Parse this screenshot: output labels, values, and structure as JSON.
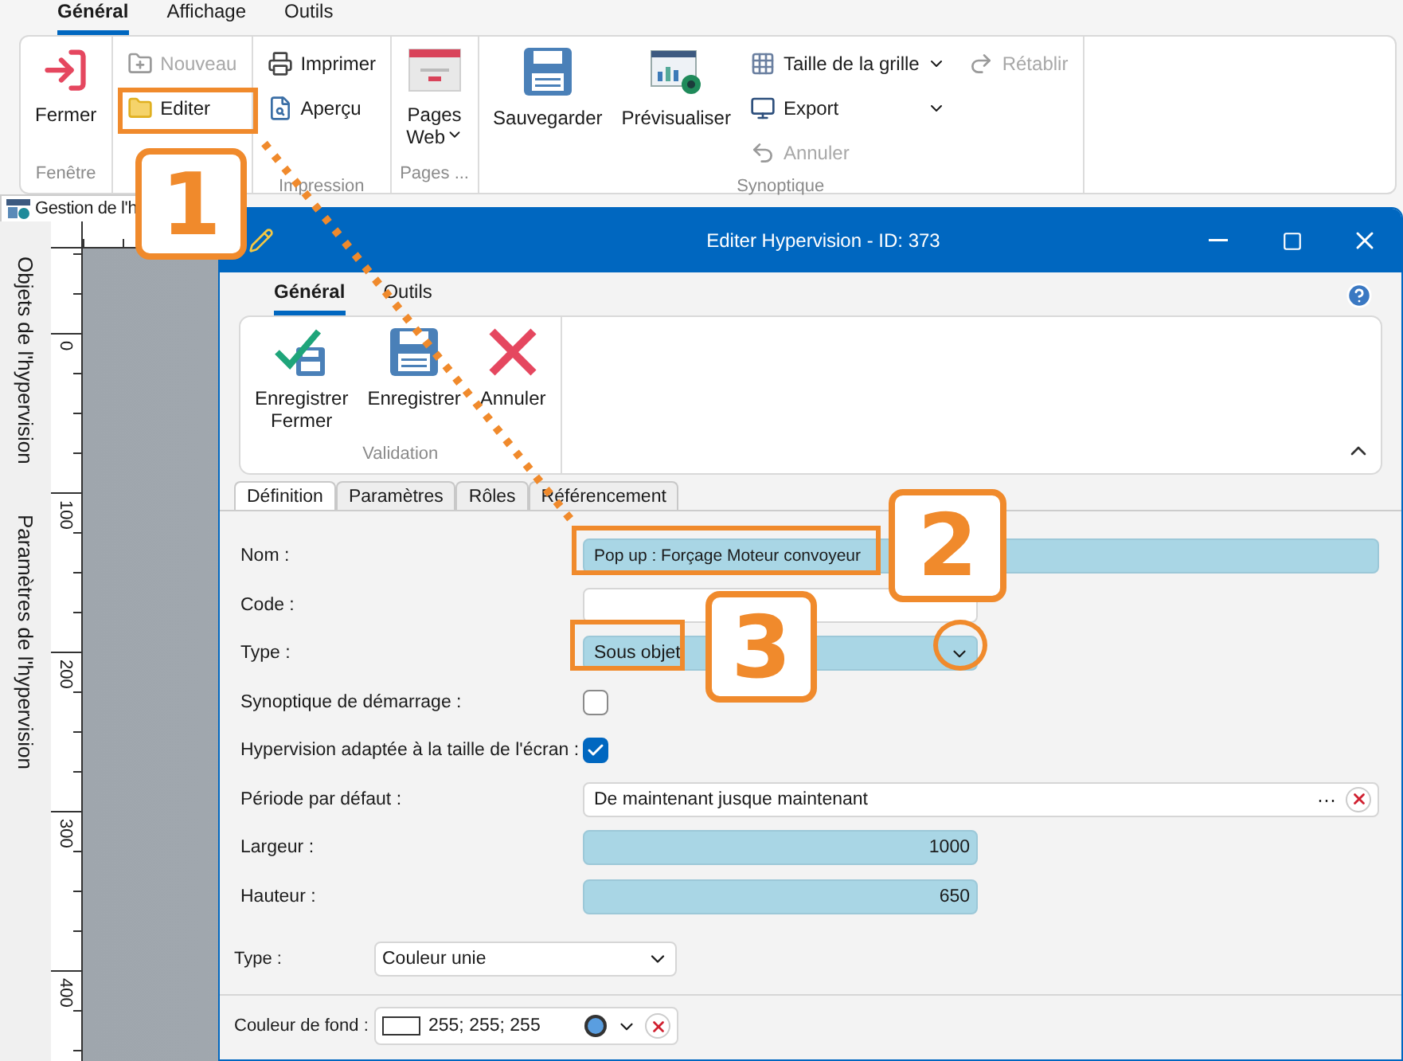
{
  "main_tabs": [
    {
      "label": "Général",
      "selected": true
    },
    {
      "label": "Affichage",
      "selected": false
    },
    {
      "label": "Outils",
      "selected": false
    }
  ],
  "main_ribbon": [
    {
      "label": "Fenêtre",
      "items": [
        {
          "label": "Fermer",
          "kind": "large",
          "disabled": false,
          "dropdown": false
        }
      ]
    },
    {
      "items": [
        {
          "label": "Nouveau",
          "kind": "small",
          "disabled": true,
          "dropdown": false
        },
        {
          "label": "Editer",
          "kind": "small",
          "disabled": false,
          "dropdown": false
        }
      ]
    },
    {
      "label": "Impression",
      "items": [
        {
          "label": "Imprimer",
          "kind": "small",
          "disabled": false,
          "dropdown": false
        },
        {
          "label": "Aperçu",
          "kind": "small",
          "disabled": false,
          "dropdown": false
        }
      ]
    },
    {
      "label": "Pages ...",
      "items": [
        {
          "label": "Pages\nWeb",
          "kind": "large",
          "disabled": false,
          "dropdown": true
        }
      ]
    },
    {
      "label": "Synoptique",
      "items": [
        {
          "label": "Sauvegarder",
          "kind": "large",
          "disabled": false,
          "dropdown": false
        },
        {
          "label": "Prévisualiser",
          "kind": "large",
          "disabled": false,
          "dropdown": false
        },
        {
          "label": "Taille de la grille",
          "kind": "small",
          "disabled": false,
          "dropdown": true
        },
        {
          "label": "Export",
          "kind": "small",
          "disabled": false,
          "dropdown": true
        },
        {
          "label": "Annuler",
          "kind": "small",
          "disabled": true,
          "dropdown": false
        },
        {
          "label": "Rétablir",
          "kind": "small",
          "disabled": true,
          "dropdown": false
        }
      ]
    }
  ],
  "document_tab": "Gestion de l'h",
  "side_panels": [
    "Objets de l'hypervision",
    "Paramètres de l'hypervision"
  ],
  "ruler_labels": [
    "0",
    "100",
    "200",
    "300",
    "400"
  ],
  "dialog": {
    "title": "Editer Hypervision - ID: 373",
    "tabs": [
      {
        "label": "Général",
        "selected": true
      },
      {
        "label": "Outils",
        "selected": false
      }
    ],
    "ribbon": [
      {
        "label": "Validation",
        "items": [
          {
            "label": "Enregistrer\nFermer",
            "kind": "large",
            "disabled": false,
            "dropdown": false
          },
          {
            "label": "Enregistrer",
            "kind": "large",
            "disabled": false,
            "dropdown": false
          },
          {
            "label": "Annuler",
            "kind": "large",
            "disabled": false,
            "dropdown": false
          }
        ]
      }
    ],
    "form_tabs": [
      {
        "label": "Définition",
        "selected": true
      },
      {
        "label": "Paramètres",
        "selected": false
      },
      {
        "label": "Rôles",
        "selected": false
      },
      {
        "label": "Référencement",
        "selected": false
      }
    ],
    "fields": [
      {
        "label": "Nom :",
        "kind": "text",
        "value": "Pop up : Forçage Moteur convoyeur",
        "required": true
      },
      {
        "label": "Code :",
        "kind": "short-text",
        "required": false
      },
      {
        "label": "Type :",
        "kind": "dropdown",
        "value": "Sous objet",
        "required": true
      },
      {
        "label": "Synoptique de démarrage :",
        "kind": "checkbox",
        "checked": false
      },
      {
        "label": "Hypervision adaptée à la taille de l'écran :",
        "kind": "checkbox",
        "checked": true
      },
      {
        "label": "Période par défaut :",
        "kind": "period",
        "value": "De maintenant jusque maintenant",
        "more_label": "···"
      },
      {
        "label": "Largeur :",
        "kind": "number",
        "value": "1000",
        "required": true
      },
      {
        "label": "Hauteur :",
        "kind": "number",
        "value": "650",
        "required": true
      }
    ],
    "background": {
      "type_label": "Type :",
      "type_value": "Couleur unie",
      "color_label": "Couleur de fond :",
      "color_value": "255; 255; 255"
    }
  },
  "annotations": [
    {
      "label": "1"
    },
    {
      "label": "2"
    },
    {
      "label": "3"
    }
  ]
}
